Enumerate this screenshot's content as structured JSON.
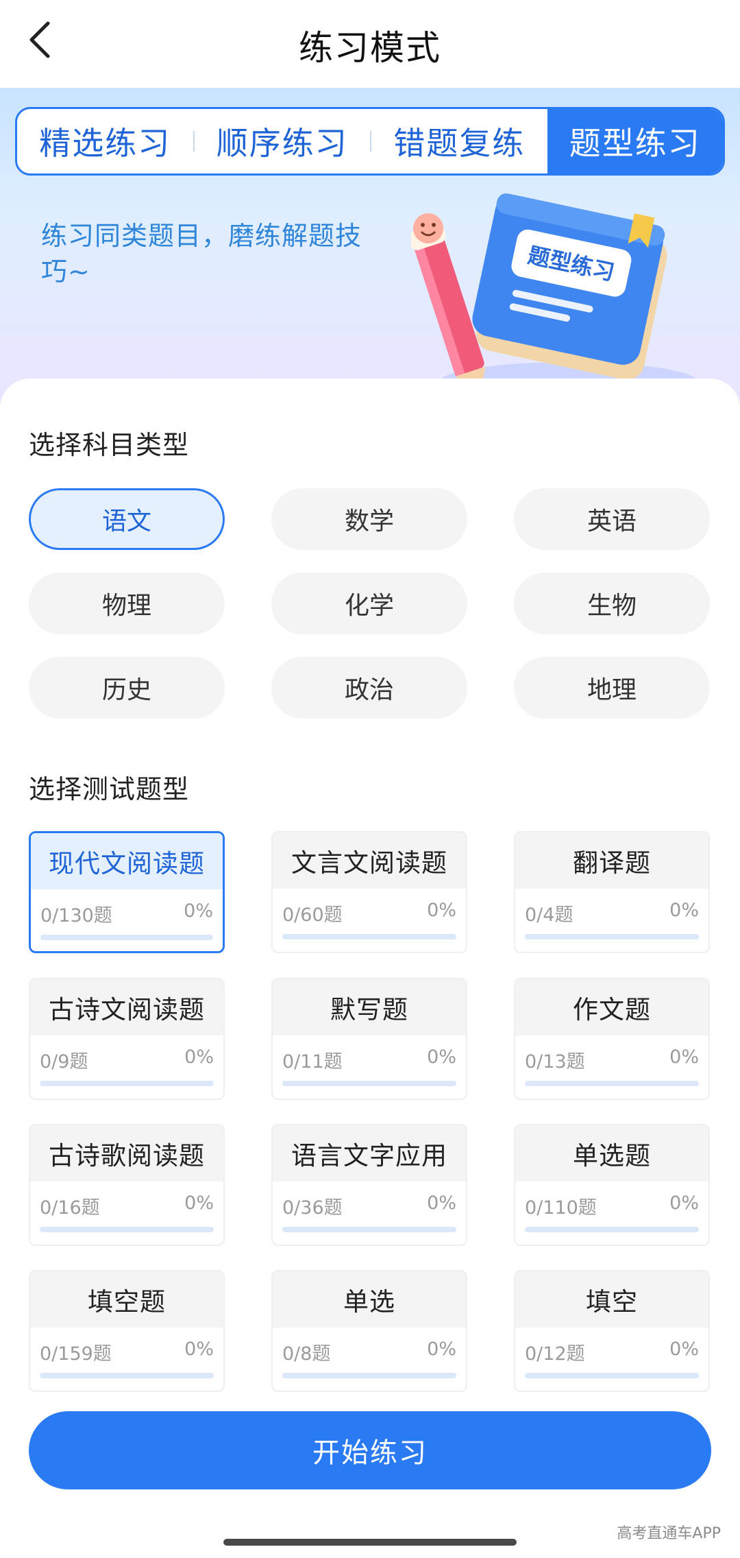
{
  "nav": {
    "title": "练习模式"
  },
  "tabs": [
    {
      "label": "精选练习",
      "active": false
    },
    {
      "label": "顺序练习",
      "active": false
    },
    {
      "label": "错题复练",
      "active": false
    },
    {
      "label": "题型练习",
      "active": true
    }
  ],
  "hero": {
    "text": "练习同类题目，磨练解题技巧~",
    "book_label": "题型练习"
  },
  "subjects": {
    "title": "选择科目类型",
    "items": [
      {
        "label": "语文",
        "selected": true
      },
      {
        "label": "数学",
        "selected": false
      },
      {
        "label": "英语",
        "selected": false
      },
      {
        "label": "物理",
        "selected": false
      },
      {
        "label": "化学",
        "selected": false
      },
      {
        "label": "生物",
        "selected": false
      },
      {
        "label": "历史",
        "selected": false
      },
      {
        "label": "政治",
        "selected": false
      },
      {
        "label": "地理",
        "selected": false
      }
    ]
  },
  "question_types": {
    "title": "选择测试题型",
    "items": [
      {
        "label": "现代文阅读题",
        "count": "0/130题",
        "percent": "0%",
        "progress": 0,
        "selected": true
      },
      {
        "label": "文言文阅读题",
        "count": "0/60题",
        "percent": "0%",
        "progress": 0,
        "selected": false
      },
      {
        "label": "翻译题",
        "count": "0/4题",
        "percent": "0%",
        "progress": 0,
        "selected": false
      },
      {
        "label": "古诗文阅读题",
        "count": "0/9题",
        "percent": "0%",
        "progress": 0,
        "selected": false
      },
      {
        "label": "默写题",
        "count": "0/11题",
        "percent": "0%",
        "progress": 0,
        "selected": false
      },
      {
        "label": "作文题",
        "count": "0/13题",
        "percent": "0%",
        "progress": 0,
        "selected": false
      },
      {
        "label": "古诗歌阅读题",
        "count": "0/16题",
        "percent": "0%",
        "progress": 0,
        "selected": false
      },
      {
        "label": "语言文字应用",
        "count": "0/36题",
        "percent": "0%",
        "progress": 0,
        "selected": false
      },
      {
        "label": "单选题",
        "count": "0/110题",
        "percent": "0%",
        "progress": 0,
        "selected": false
      },
      {
        "label": "填空题",
        "count": "0/159题",
        "percent": "0%",
        "progress": 0,
        "selected": false
      },
      {
        "label": "单选",
        "count": "0/8题",
        "percent": "0%",
        "progress": 0,
        "selected": false
      },
      {
        "label": "填空",
        "count": "0/12题",
        "percent": "0%",
        "progress": 0,
        "selected": false
      }
    ]
  },
  "start_button": {
    "label": "开始练习"
  },
  "watermark": "高考直通车APP",
  "colors": {
    "accent": "#2a7af3",
    "hero_text": "#2f86d8"
  }
}
